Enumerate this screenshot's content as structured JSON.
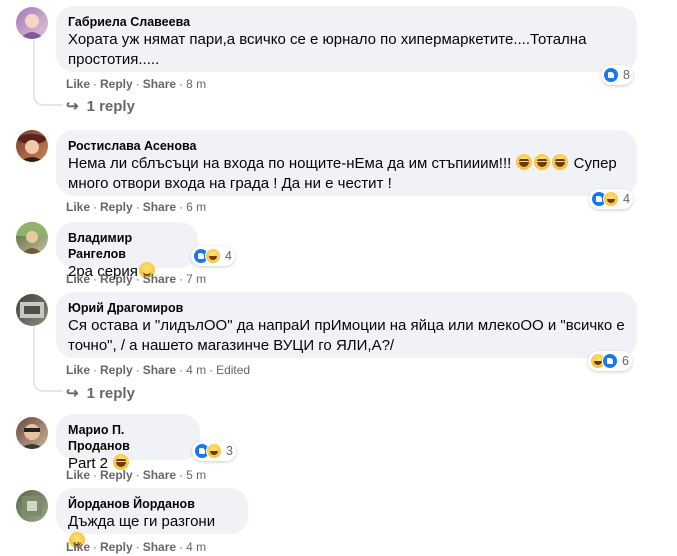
{
  "labels": {
    "like": "Like",
    "reply": "Reply",
    "share": "Share",
    "sep": "·"
  },
  "comments": [
    {
      "author": "Габриела Славеева",
      "text": "Хората уж нямат пари,а всичко се е юрнало по хипермаркетите....Тотална простотия.....",
      "time": "8 m",
      "reactions": [
        "like"
      ],
      "reaction_count": "8",
      "replies_link": "1 reply",
      "avatar_colors": [
        "#a07ab8",
        "#e8c3d8"
      ]
    },
    {
      "author": "Ростислава Асенова",
      "text_part1": "Нема ли сблъсъци на входа по нощите-нЕма да им стъпииим!!! ",
      "text_part2": " Супер",
      "text_line2": "много отвори входа на града ! Да ни е честит !",
      "time": "6 m",
      "reactions": [
        "like",
        "haha"
      ],
      "reaction_count": "4",
      "avatar_colors": [
        "#7a3a2a",
        "#c98660"
      ]
    },
    {
      "author": "Владимир Рангелов",
      "text": "2ра серия",
      "time": "7 m",
      "reactions": [
        "like",
        "haha"
      ],
      "reaction_count": "4",
      "avatar_colors": [
        "#4f6a3a",
        "#c7c09a"
      ]
    },
    {
      "author": "Юрий Драгомиров",
      "text_line1": "Ся остава и \"лидълОО\" да напраИ прИмоции на яйца или млекоОО и \"всичко е",
      "text_line2": "точно\", / а нашето магазинче ВУЦИ го ЯЛИ,А?/",
      "time": "4 m",
      "edited": "Edited",
      "reactions": [
        "haha",
        "like"
      ],
      "reaction_count": "6",
      "replies_link": "1 reply",
      "avatar_colors": [
        "#3a3f38",
        "#8a8f82"
      ]
    },
    {
      "author": "Марио П. Проданов",
      "text": "Part 2",
      "time": "5 m",
      "reactions": [
        "like",
        "haha"
      ],
      "reaction_count": "3",
      "avatar_colors": [
        "#6b4a3a",
        "#c9b29a"
      ]
    },
    {
      "author": "Йорданов Йорданов",
      "text": "Дъжда ще ги разгони",
      "time": "4 m",
      "avatar_colors": [
        "#5a6b4a",
        "#9aa58a"
      ]
    }
  ]
}
